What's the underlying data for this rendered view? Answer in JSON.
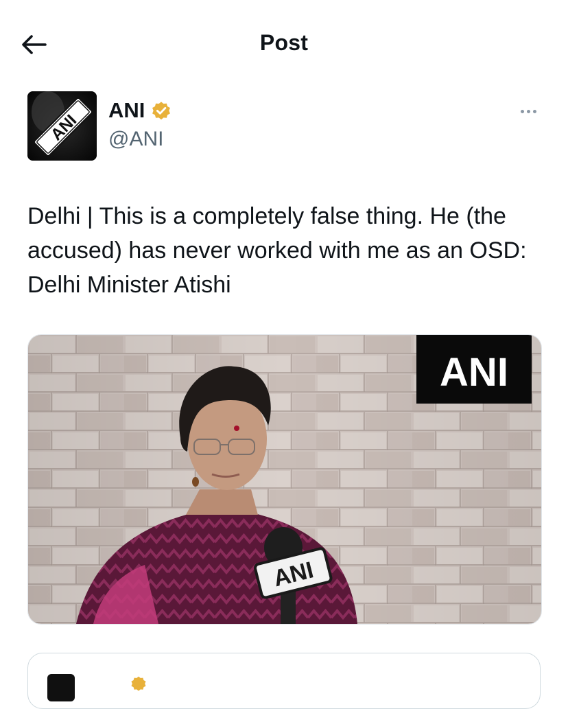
{
  "header": {
    "title": "Post",
    "back_icon": "arrow-left-icon"
  },
  "author": {
    "display_name": "ANI",
    "handle": "@ANI",
    "verified": true,
    "verified_color": "#F4B400",
    "avatar_logo_text": "ANI",
    "more_icon": "more-horizontal-icon"
  },
  "post": {
    "text": "Delhi | This is a completely false thing. He (the accused) has never worked with me as an OSD: Delhi Minister Atishi"
  },
  "media": {
    "watermark": "ANI",
    "mic_flag_text": "ANI"
  },
  "colors": {
    "text_primary": "#0F1419",
    "text_secondary": "#536471",
    "border": "#CFD9DE"
  }
}
